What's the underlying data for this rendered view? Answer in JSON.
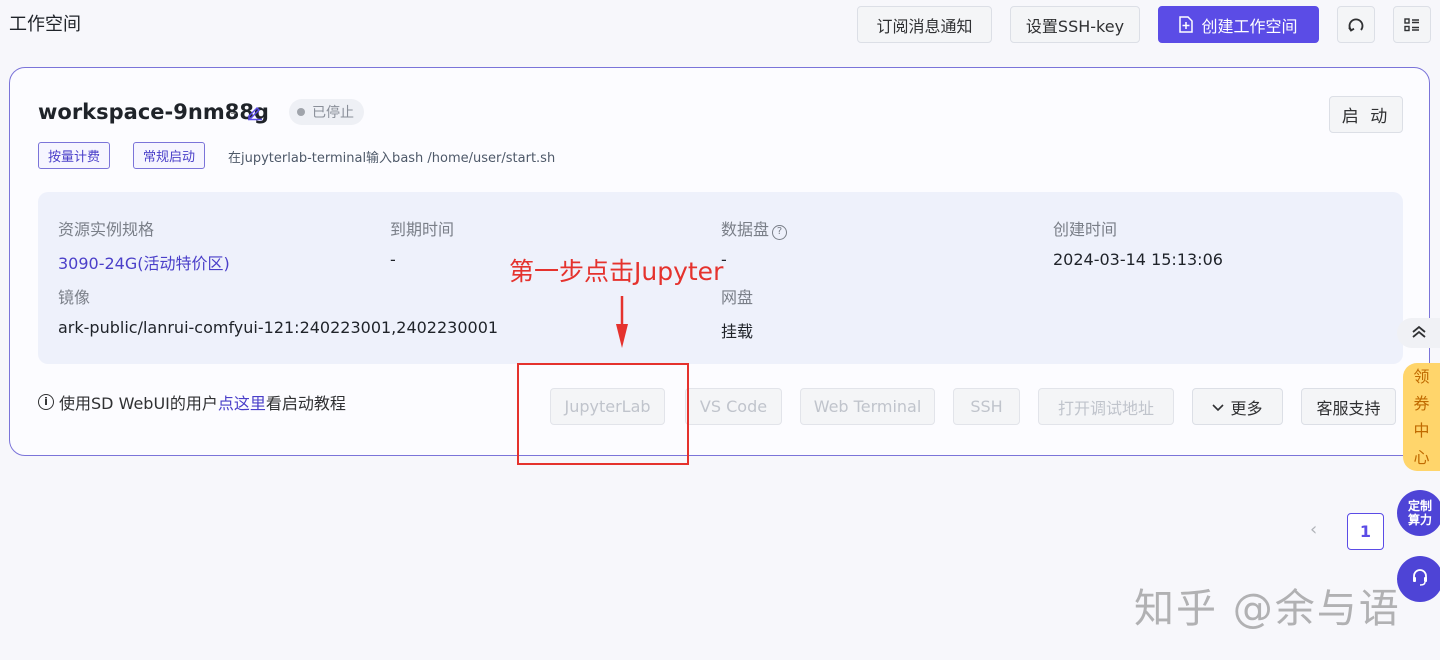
{
  "header": {
    "title": "工作空间",
    "subscribe_label": "订阅消息通知",
    "ssh_key_label": "设置SSH-key",
    "create_label": "创建工作空间"
  },
  "workspace": {
    "name": "workspace-9nm88g",
    "name_separator": "-",
    "status": "已停止",
    "start_label": "启 动",
    "tags": [
      "按量计费",
      "常规启动"
    ],
    "startup_note": "在jupyterlab-terminal输入bash /home/user/start.sh"
  },
  "info": {
    "spec_label": "资源实例规格",
    "spec_value": "3090-24G(活动特价区)",
    "expire_label": "到期时间",
    "expire_value": "-",
    "disk_label": "数据盘",
    "disk_value": "-",
    "created_label": "创建时间",
    "created_value": "2024-03-14 15:13:06",
    "image_label": "镜像",
    "image_value": "ark-public/lanrui-comfyui-121:240223001,2402230001",
    "netdisk_label": "网盘",
    "netdisk_value": "挂载"
  },
  "annotation": {
    "text": "第一步点击Jupyter"
  },
  "tutorial": {
    "prefix": "使用SD WebUI的用户",
    "link": "点这里",
    "suffix": "看启动教程"
  },
  "actions": {
    "jupyterlab": "JupyterLab",
    "vscode": "VS Code",
    "web_terminal": "Web Terminal",
    "ssh": "SSH",
    "debug_address": "打开调试地址",
    "more": "更多",
    "support": "客服支持"
  },
  "pagination": {
    "current_page": "1"
  },
  "watermark": "知乎 @余与语",
  "floating": {
    "coupon_chars": [
      "领",
      "券",
      "中",
      "心"
    ],
    "compute_line1": "定制",
    "compute_line2": "算力"
  },
  "colors": {
    "accent": "#5b4ce6",
    "annotation_red": "#e5322d",
    "coupon_yellow": "#ffd56b"
  }
}
